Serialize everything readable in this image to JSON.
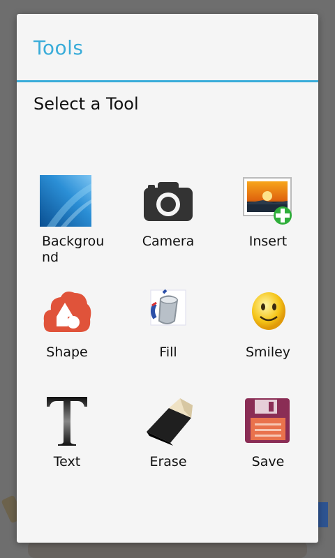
{
  "dialog": {
    "title": "Tools",
    "subtitle": "Select a Tool"
  },
  "tools": [
    {
      "id": "background",
      "label": "Background",
      "icon": "background-icon"
    },
    {
      "id": "camera",
      "label": "Camera",
      "icon": "camera-icon"
    },
    {
      "id": "insert",
      "label": "Insert",
      "icon": "insert-image-icon"
    },
    {
      "id": "shape",
      "label": "Shape",
      "icon": "shape-icon"
    },
    {
      "id": "fill",
      "label": "Fill",
      "icon": "fill-bucket-icon"
    },
    {
      "id": "smiley",
      "label": "Smiley",
      "icon": "smiley-icon"
    },
    {
      "id": "text",
      "label": "Text",
      "icon": "text-icon"
    },
    {
      "id": "erase",
      "label": "Erase",
      "icon": "eraser-icon"
    },
    {
      "id": "save",
      "label": "Save",
      "icon": "save-icon"
    }
  ],
  "colors": {
    "accent": "#39acd9",
    "dialog_bg": "#f5f5f5",
    "overlay": "#6e6e6e"
  }
}
